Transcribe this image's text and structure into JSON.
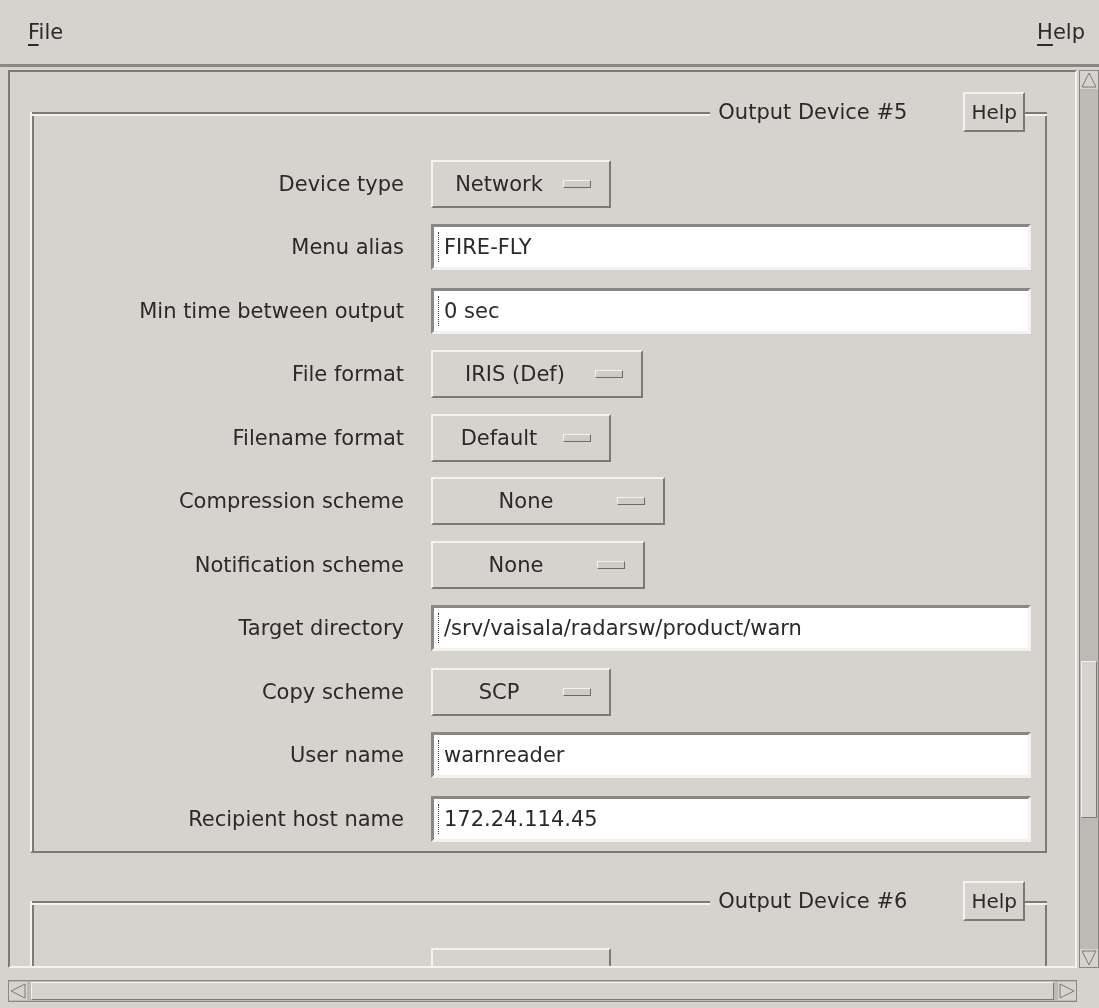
{
  "menubar": [
    {
      "label": "File"
    },
    {
      "label": "Help"
    }
  ],
  "devices": [
    {
      "title": "Output Device #5",
      "help": "Help",
      "fields": [
        {
          "kind": "menu",
          "label": "Device type",
          "value": "Network"
        },
        {
          "kind": "text",
          "label": "Menu alias",
          "value": "FIRE-FLY"
        },
        {
          "kind": "text",
          "label": "Min time between output",
          "value": "0 sec"
        },
        {
          "kind": "menu",
          "label": "File format",
          "value": "IRIS (Def)"
        },
        {
          "kind": "menu",
          "label": "Filename format",
          "value": "Default"
        },
        {
          "kind": "menu",
          "label": "Compression scheme",
          "value": "None"
        },
        {
          "kind": "menu",
          "label": "Notification scheme",
          "value": "None"
        },
        {
          "kind": "text",
          "label": "Target directory",
          "value": "/srv/vaisala/radarsw/product/warn"
        },
        {
          "kind": "menu",
          "label": "Copy scheme",
          "value": "SCP"
        },
        {
          "kind": "text",
          "label": "User name",
          "value": "warnreader"
        },
        {
          "kind": "text",
          "label": "Recipient host name",
          "value": "172.24.114.45"
        }
      ]
    },
    {
      "title": "Output Device #6",
      "help": "Help",
      "fields": [
        {
          "kind": "menu"
        }
      ]
    }
  ]
}
